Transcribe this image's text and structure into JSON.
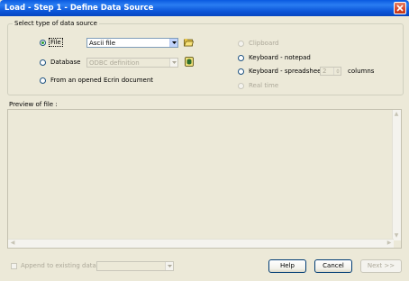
{
  "window": {
    "title": "Load - Step 1 - Define Data Source"
  },
  "source_group": {
    "legend": "Select type of data source",
    "file": {
      "label": "File",
      "selected": true,
      "combo_value": "Ascii file"
    },
    "database": {
      "label": "Database",
      "selected": false,
      "combo_value": "ODBC definition"
    },
    "opened_doc": {
      "label": "From an opened Ecrin document",
      "selected": false
    },
    "clipboard": {
      "label": "Clipboard",
      "enabled": false
    },
    "keyboard_notepad": {
      "label": "Keyboard - notepad"
    },
    "keyboard_spreadsheet": {
      "label": "Keyboard - spreadsheet",
      "spin_value": "2",
      "columns_label": "columns"
    },
    "real_time": {
      "label": "Real time",
      "enabled": false
    }
  },
  "preview": {
    "label": "Preview of file :"
  },
  "footer": {
    "append_label": "Append to existing data",
    "help_label": "Help",
    "cancel_label": "Cancel",
    "next_label": "Next >>"
  },
  "icons": {
    "close": "close-icon",
    "file_open": "folder-open-icon",
    "database_config": "database-icon",
    "dropdown": "chevron-down-icon"
  }
}
